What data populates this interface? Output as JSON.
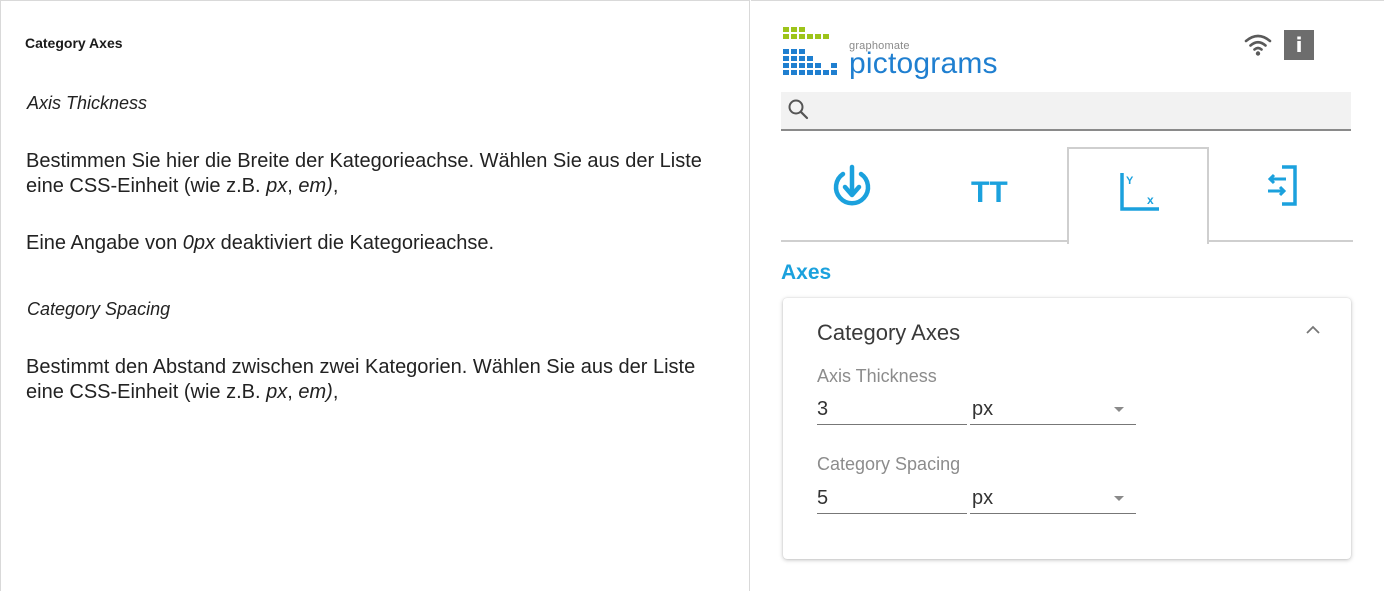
{
  "doc": {
    "heading": "Category Axes",
    "axis_thickness": {
      "subheading": "Axis Thickness",
      "para1_a": "Bestimmen Sie hier die Breite der Kategorieachse. Wählen Sie aus der Liste eine CSS-Einheit (wie z.B. ",
      "para1_px": "px",
      "para1_sep": ", ",
      "para1_em": "em)",
      "para1_end": ",",
      "para2_a": "Eine Angabe von ",
      "para2_0px": "0px",
      "para2_b": " deaktiviert die Kategorieachse."
    },
    "category_spacing": {
      "subheading": "Category Spacing",
      "para1_a": "Bestimmt den Abstand zwischen zwei Kategorien. Wählen Sie aus der Liste eine CSS-Einheit (wie z.B. ",
      "para1_px": "px",
      "para1_sep": ", ",
      "para1_em": "em)",
      "para1_end": ","
    }
  },
  "panel": {
    "logo_small": "graphomate",
    "logo_big": "pictograms",
    "brand_colors": {
      "logo_blue": "#1f7fd0",
      "logo_green": "#9dc41a",
      "accent": "#1ba1dd"
    },
    "icons": [
      "wifi-icon",
      "info-icon",
      "search-icon",
      "data-refresh-icon",
      "text-format-icon",
      "axes-icon",
      "export-icon",
      "chevron-up-icon"
    ],
    "info_label": "i",
    "search_placeholder": "",
    "tabs": [
      {
        "name": "data",
        "icon": "data-refresh-icon"
      },
      {
        "name": "text",
        "icon": "text-format-icon",
        "label": "TT"
      },
      {
        "name": "axes",
        "icon": "axes-icon",
        "active": true,
        "label_y": "Y",
        "label_x": "x"
      },
      {
        "name": "export",
        "icon": "export-icon"
      }
    ],
    "section_title": "Axes",
    "card": {
      "title": "Category Axes",
      "axis_thickness": {
        "label": "Axis Thickness",
        "value": "3",
        "unit": "px"
      },
      "category_spacing": {
        "label": "Category Spacing",
        "value": "5",
        "unit": "px"
      }
    }
  }
}
